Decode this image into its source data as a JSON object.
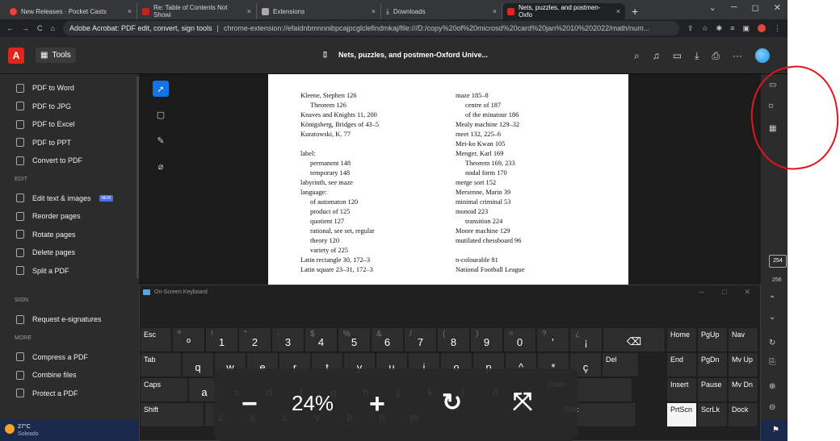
{
  "browser": {
    "tabs": [
      {
        "label": "New Releases · Pocket Casts",
        "active": false
      },
      {
        "label": "Re: Table of Contents Not Showi",
        "active": false
      },
      {
        "label": "Extensions",
        "active": false
      },
      {
        "label": "Downloads",
        "active": false
      },
      {
        "label": "Nets, puzzles, and postmen-Oxfo",
        "active": true
      }
    ],
    "address_title": "Adobe Acrobat: PDF edit, convert, sign tools",
    "url": "chrome-extension://efaidnbmnnnibpcajpcglclefindmkaj/file:///D:/copy%20of%20microsd%20card%20jan%2010%202022/math/num..."
  },
  "acrobat": {
    "tools_label": "Tools",
    "doc_title": "Nets, puzzles, and postmen-Oxford Unive..."
  },
  "sidebar": {
    "convert": [
      "PDF to Word",
      "PDF to JPG",
      "PDF to Excel",
      "PDF to PPT",
      "Convert to PDF"
    ],
    "edit_header": "EDIT",
    "edit": [
      {
        "label": "Edit text & images",
        "badge": "NEW"
      },
      {
        "label": "Reorder pages"
      },
      {
        "label": "Rotate pages"
      },
      {
        "label": "Delete pages"
      },
      {
        "label": "Split a PDF"
      }
    ],
    "sign_header": "SIGN",
    "sign": [
      "Request e-signatures"
    ],
    "more_header": "MORE",
    "more": [
      "Compress a PDF",
      "Combine files",
      "Protect a PDF"
    ]
  },
  "page": {
    "left_col": [
      {
        "t": "Kleene, Stephen  126",
        "i": false
      },
      {
        "t": "Theorem  126",
        "i": true
      },
      {
        "t": "Knaves and Knights  11, 200",
        "i": false
      },
      {
        "t": "Königsberg, Bridges of  43–5",
        "i": false
      },
      {
        "t": "Kuratowski, K.  77",
        "i": false
      },
      {
        "t": "",
        "i": false
      },
      {
        "t": "label:",
        "i": false
      },
      {
        "t": "permanent  148",
        "i": true
      },
      {
        "t": "temporary  148",
        "i": true
      },
      {
        "t": "labyrinth, see maze",
        "i": false
      },
      {
        "t": "language:",
        "i": false
      },
      {
        "t": "of automaton  120",
        "i": true
      },
      {
        "t": "product of  125",
        "i": true
      },
      {
        "t": "quotient  127",
        "i": true
      },
      {
        "t": "rational, see set, regular",
        "i": true
      },
      {
        "t": "theory  120",
        "i": true
      },
      {
        "t": "variety of  225",
        "i": true
      },
      {
        "t": "Latin rectangle  30, 172–3",
        "i": false
      },
      {
        "t": "Latin square  23–31, 172–3",
        "i": false
      }
    ],
    "right_col": [
      {
        "t": "maze  185–8",
        "i": false
      },
      {
        "t": "centre of  187",
        "i": true
      },
      {
        "t": "of the minatour  186",
        "i": true
      },
      {
        "t": "Mealy machine  129–32",
        "i": false
      },
      {
        "t": "meet  132, 225–6",
        "i": false
      },
      {
        "t": "Mei-ko Kwan  105",
        "i": false
      },
      {
        "t": "Menger, Karl  169",
        "i": false
      },
      {
        "t": "Theorem  169, 233",
        "i": true
      },
      {
        "t": "nodal form  170",
        "i": true
      },
      {
        "t": "merge sort  152",
        "i": false
      },
      {
        "t": "Mersenne, Marin  39",
        "i": false
      },
      {
        "t": "minimal criminal  53",
        "i": false
      },
      {
        "t": "monoid  223",
        "i": false
      },
      {
        "t": "transition  224",
        "i": true
      },
      {
        "t": "Moore machine  129",
        "i": false
      },
      {
        "t": "mutilated chessboard  96",
        "i": false
      },
      {
        "t": "",
        "i": false
      },
      {
        "t": "n-colourable  81",
        "i": false
      },
      {
        "t": "National Football League",
        "i": false
      }
    ]
  },
  "right_panel": {
    "page_current": "254",
    "page_next": "256"
  },
  "osk": {
    "title": "On-Screen Keyboard",
    "row1": [
      {
        "m": "Esc"
      },
      {
        "s": "ª",
        "m": "º"
      },
      {
        "s": "!",
        "m": "1"
      },
      {
        "s": "\"",
        "m": "2"
      },
      {
        "s": "·",
        "m": "3"
      },
      {
        "s": "$",
        "m": "4"
      },
      {
        "s": "%",
        "m": "5"
      },
      {
        "s": "&",
        "m": "6"
      },
      {
        "s": "/",
        "m": "7"
      },
      {
        "s": "(",
        "m": "8"
      },
      {
        "s": ")",
        "m": "9"
      },
      {
        "s": "=",
        "m": "0"
      },
      {
        "s": "?",
        "m": "'"
      },
      {
        "s": "¿",
        "m": "¡"
      },
      {
        "m": "⌫"
      }
    ],
    "row2": [
      "Tab",
      "q",
      "w",
      "e",
      "r",
      "t",
      "y",
      "u",
      "i",
      "o",
      "p",
      "^",
      "*",
      "ç",
      "Del"
    ],
    "row3": [
      "Caps",
      "a",
      "s",
      "d",
      "f",
      "g",
      "h",
      "j",
      "k",
      "l",
      "ñ",
      "",
      "Enter"
    ],
    "row4": [
      "Shift",
      "z",
      "x",
      "c",
      "v",
      "b",
      "n",
      "m",
      "",
      "",
      "",
      "",
      "Shift"
    ],
    "nav": [
      [
        "Home",
        "PgUp",
        "Nav"
      ],
      [
        "End",
        "PgDn",
        "Mv Up"
      ],
      [
        "Insert",
        "Pause",
        "Mv Dn"
      ],
      [
        "PrtScn",
        "ScrLk",
        "Dock"
      ]
    ]
  },
  "zoom": {
    "minus": "−",
    "value": "24%",
    "plus": "+"
  },
  "taskbar": {
    "temp": "27°C",
    "weather": "Soleado"
  }
}
